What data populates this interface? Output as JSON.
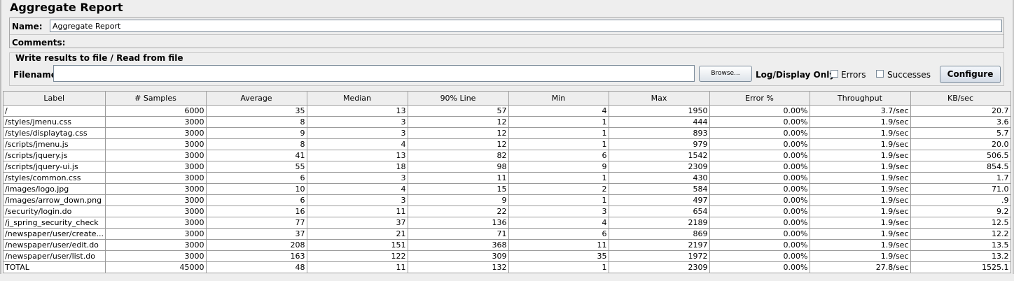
{
  "title": "Aggregate Report",
  "name_label": "Name:",
  "name_value": "Aggregate Report",
  "comments_label": "Comments:",
  "file_section": {
    "legend": "Write results to file / Read from file",
    "filename_label": "Filename",
    "filename_value": "",
    "browse_label": "Browse...",
    "log_display_label": "Log/Display Only:",
    "errors_label": "Errors",
    "successes_label": "Successes",
    "configure_label": "Configure"
  },
  "table": {
    "columns": [
      "Label",
      "# Samples",
      "Average",
      "Median",
      "90% Line",
      "Min",
      "Max",
      "Error %",
      "Throughput",
      "KB/sec"
    ],
    "rows": [
      [
        "/",
        "6000",
        "35",
        "13",
        "57",
        "4",
        "1950",
        "0.00%",
        "3.7/sec",
        "20.7"
      ],
      [
        "/styles/jmenu.css",
        "3000",
        "8",
        "3",
        "12",
        "1",
        "444",
        "0.00%",
        "1.9/sec",
        "3.6"
      ],
      [
        "/styles/displaytag.css",
        "3000",
        "9",
        "3",
        "12",
        "1",
        "893",
        "0.00%",
        "1.9/sec",
        "5.7"
      ],
      [
        "/scripts/jmenu.js",
        "3000",
        "8",
        "4",
        "12",
        "1",
        "979",
        "0.00%",
        "1.9/sec",
        "20.0"
      ],
      [
        "/scripts/jquery.js",
        "3000",
        "41",
        "13",
        "82",
        "6",
        "1542",
        "0.00%",
        "1.9/sec",
        "506.5"
      ],
      [
        "/scripts/jquery-ui.js",
        "3000",
        "55",
        "18",
        "98",
        "9",
        "2309",
        "0.00%",
        "1.9/sec",
        "854.5"
      ],
      [
        "/styles/common.css",
        "3000",
        "6",
        "3",
        "11",
        "1",
        "430",
        "0.00%",
        "1.9/sec",
        "1.7"
      ],
      [
        "/images/logo.jpg",
        "3000",
        "10",
        "4",
        "15",
        "2",
        "584",
        "0.00%",
        "1.9/sec",
        "71.0"
      ],
      [
        "/images/arrow_down.png",
        "3000",
        "6",
        "3",
        "9",
        "1",
        "497",
        "0.00%",
        "1.9/sec",
        ".9"
      ],
      [
        "/security/login.do",
        "3000",
        "16",
        "11",
        "22",
        "3",
        "654",
        "0.00%",
        "1.9/sec",
        "9.2"
      ],
      [
        "/j_spring_security_check",
        "3000",
        "77",
        "37",
        "136",
        "4",
        "2189",
        "0.00%",
        "1.9/sec",
        "12.5"
      ],
      [
        "/newspaper/user/create...",
        "3000",
        "37",
        "21",
        "71",
        "6",
        "869",
        "0.00%",
        "1.9/sec",
        "12.2"
      ],
      [
        "/newspaper/user/edit.do",
        "3000",
        "208",
        "151",
        "368",
        "11",
        "2197",
        "0.00%",
        "1.9/sec",
        "13.5"
      ],
      [
        "/newspaper/user/list.do",
        "3000",
        "163",
        "122",
        "309",
        "35",
        "1972",
        "0.00%",
        "1.9/sec",
        "13.2"
      ],
      [
        "TOTAL",
        "45000",
        "48",
        "11",
        "132",
        "1",
        "2309",
        "0.00%",
        "27.8/sec",
        "1525.1"
      ]
    ]
  }
}
